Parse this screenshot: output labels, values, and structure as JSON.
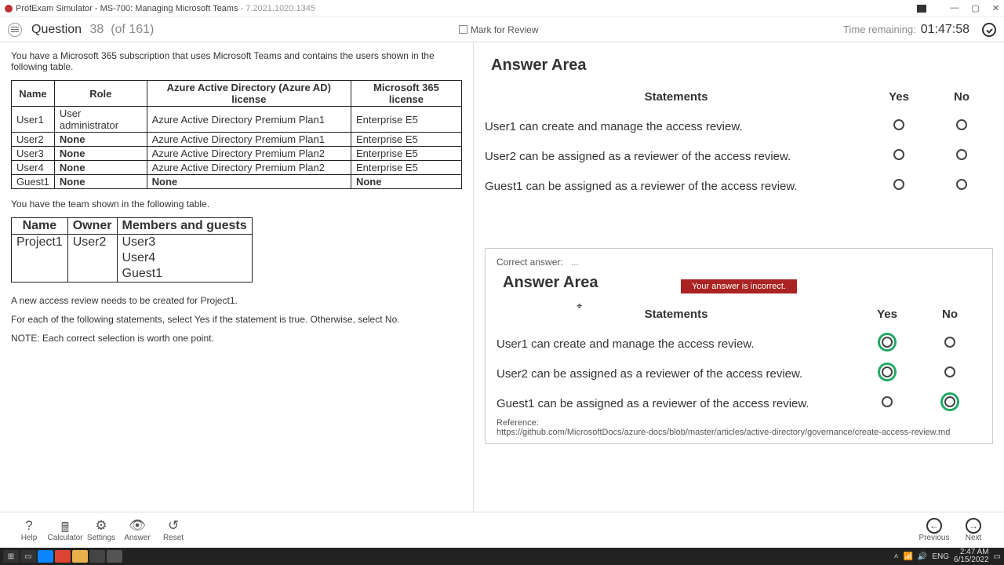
{
  "titlebar": {
    "app": "ProfExam Simulator",
    "doc": "MS-700: Managing Microsoft Teams",
    "ver": "- 7.2021.1020.1345"
  },
  "header": {
    "question_label": "Question",
    "question_num": "38",
    "question_of": "(of 161)",
    "mark_label": "Mark for Review",
    "timer_label": "Time remaining:",
    "timer_value": "01:47:58"
  },
  "question": {
    "line1": "You have a Microsoft 365 subscription that uses Microsoft Teams and contains the users shown in the following table.",
    "table1_headers": [
      "Name",
      "Role",
      "Azure Active Directory (Azure AD) license",
      "Microsoft 365 license"
    ],
    "table1_rows": [
      [
        "User1",
        "User administrator",
        "Azure Active Directory Premium Plan1",
        "Enterprise E5"
      ],
      [
        "User2",
        "None",
        "Azure Active Directory Premium Plan1",
        "Enterprise E5"
      ],
      [
        "User3",
        "None",
        "Azure Active Directory Premium Plan2",
        "Enterprise E5"
      ],
      [
        "User4",
        "None",
        "Azure Active Directory Premium Plan2",
        "Enterprise E5"
      ],
      [
        "Guest1",
        "None",
        "None",
        "None"
      ]
    ],
    "line2": "You have the team shown in the following table.",
    "table2_headers": [
      "Name",
      "Owner",
      "Members and guests"
    ],
    "table2_rows": [
      [
        "Project1",
        "User2",
        "User3"
      ],
      [
        "",
        "",
        "User4"
      ],
      [
        "",
        "",
        "Guest1"
      ]
    ],
    "line3": "A new access review needs to be created for Project1.",
    "line4": "For each of the following statements, select Yes if the statement is true. Otherwise, select No.",
    "line5": "NOTE: Each correct selection is worth one point."
  },
  "answer": {
    "area_title": "Answer Area",
    "col_stmt": "Statements",
    "col_yes": "Yes",
    "col_no": "No",
    "rows": [
      "User1 can create and manage the access review.",
      "User2 can be assigned as a reviewer of the access review.",
      "Guest1 can be assigned as a reviewer of the access review."
    ],
    "incorrect_msg": "Your answer is incorrect.",
    "correct_label": "Correct answer:",
    "correct_keys": [
      "yes",
      "yes",
      "no"
    ],
    "ref_label": "Reference:",
    "ref_url": "https://github.com/MicrosoftDocs/azure-docs/blob/master/articles/active-directory/governance/create-access-review.md"
  },
  "bottom": {
    "help": "Help",
    "calc": "Calculator",
    "settings": "Settings",
    "answer": "Answer",
    "reset": "Reset",
    "prev": "Previous",
    "next": "Next"
  },
  "tray": {
    "lang": "ENG",
    "time": "2:47 AM",
    "date": "6/15/2022"
  }
}
